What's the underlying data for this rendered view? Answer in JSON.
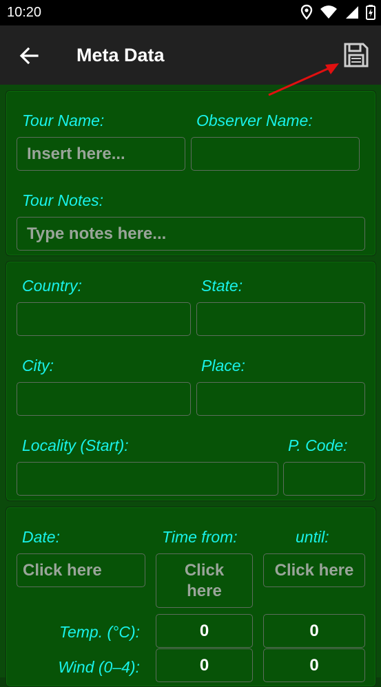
{
  "status": {
    "time": "10:20"
  },
  "appbar": {
    "title": "Meta Data"
  },
  "tour": {
    "tour_name_label": "Tour Name:",
    "tour_name_placeholder": "Insert here...",
    "observer_label": "Observer Name:",
    "notes_label": "Tour Notes:",
    "notes_placeholder": "Type notes here..."
  },
  "location": {
    "country_label": "Country:",
    "state_label": "State:",
    "city_label": "City:",
    "place_label": "Place:",
    "locality_label": "Locality (Start):",
    "pcode_label": "P. Code:"
  },
  "time": {
    "date_label": "Date:",
    "date_value": "Click here",
    "from_label": "Time from:",
    "from_value": "Click here",
    "until_label": "until:",
    "until_value": "Click here",
    "temp_label": "Temp. (°C):",
    "temp_from": "0",
    "temp_until": "0",
    "wind_label": "Wind (0–4):",
    "wind_from": "0",
    "wind_until": "0"
  },
  "colors": {
    "label": "#19f2e9",
    "card_bg": "#075307",
    "appbar_bg": "#212121",
    "arrow": "#e01010"
  }
}
